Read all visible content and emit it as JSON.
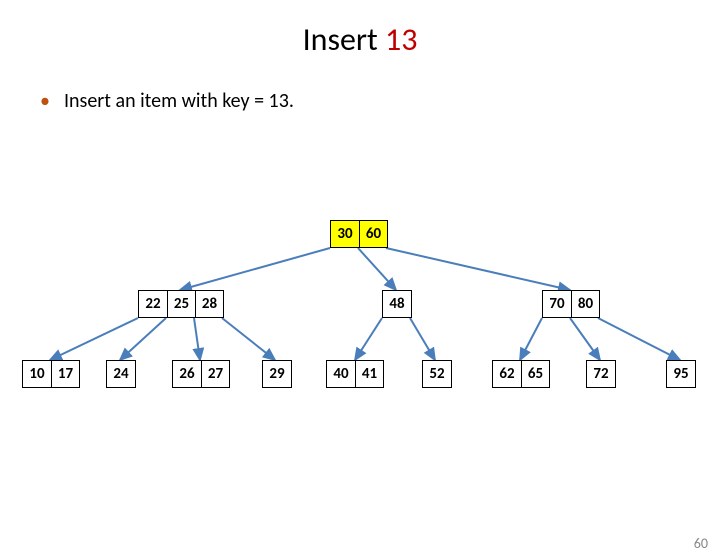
{
  "title_prefix": "Insert ",
  "title_key": "13",
  "bullet_text": "Insert an item with key = 13.",
  "page_number": "60",
  "chart_data": {
    "type": "tree",
    "description": "B-tree (2-3-4 tree) before inserting key 13",
    "levels": [
      {
        "nodes": [
          {
            "keys": [
              30,
              60
            ],
            "highlight": true
          }
        ]
      },
      {
        "nodes": [
          {
            "keys": [
              22,
              25,
              28
            ]
          },
          {
            "keys": [
              48
            ]
          },
          {
            "keys": [
              70,
              80
            ]
          }
        ]
      },
      {
        "nodes": [
          {
            "keys": [
              10,
              17
            ]
          },
          {
            "keys": [
              24
            ]
          },
          {
            "keys": [
              26,
              27
            ]
          },
          {
            "keys": [
              29
            ]
          },
          {
            "keys": [
              40,
              41
            ]
          },
          {
            "keys": [
              52
            ]
          },
          {
            "keys": [
              62,
              65
            ]
          },
          {
            "keys": [
              72
            ]
          },
          {
            "keys": [
              95
            ]
          }
        ]
      }
    ],
    "edges": [
      {
        "from": "root",
        "to": "L1-0"
      },
      {
        "from": "root",
        "to": "L1-1"
      },
      {
        "from": "root",
        "to": "L1-2"
      },
      {
        "from": "L1-0",
        "to": "L2-0"
      },
      {
        "from": "L1-0",
        "to": "L2-1"
      },
      {
        "from": "L1-0",
        "to": "L2-2"
      },
      {
        "from": "L1-0",
        "to": "L2-3"
      },
      {
        "from": "L1-1",
        "to": "L2-4"
      },
      {
        "from": "L1-1",
        "to": "L2-5"
      },
      {
        "from": "L1-2",
        "to": "L2-6"
      },
      {
        "from": "L1-2",
        "to": "L2-7"
      },
      {
        "from": "L1-2",
        "to": "L2-8"
      }
    ]
  },
  "root": {
    "k0": "30",
    "k1": "60"
  },
  "mid": {
    "n0": {
      "k0": "22",
      "k1": "25",
      "k2": "28"
    },
    "n1": {
      "k0": "48"
    },
    "n2": {
      "k0": "70",
      "k1": "80"
    }
  },
  "leaf": {
    "n0": {
      "k0": "10",
      "k1": "17"
    },
    "n1": {
      "k0": "24"
    },
    "n2": {
      "k0": "26",
      "k1": "27"
    },
    "n3": {
      "k0": "29"
    },
    "n4": {
      "k0": "40",
      "k1": "41"
    },
    "n5": {
      "k0": "52"
    },
    "n6": {
      "k0": "62",
      "k1": "65"
    },
    "n7": {
      "k0": "72"
    },
    "n8": {
      "k0": "95"
    }
  }
}
